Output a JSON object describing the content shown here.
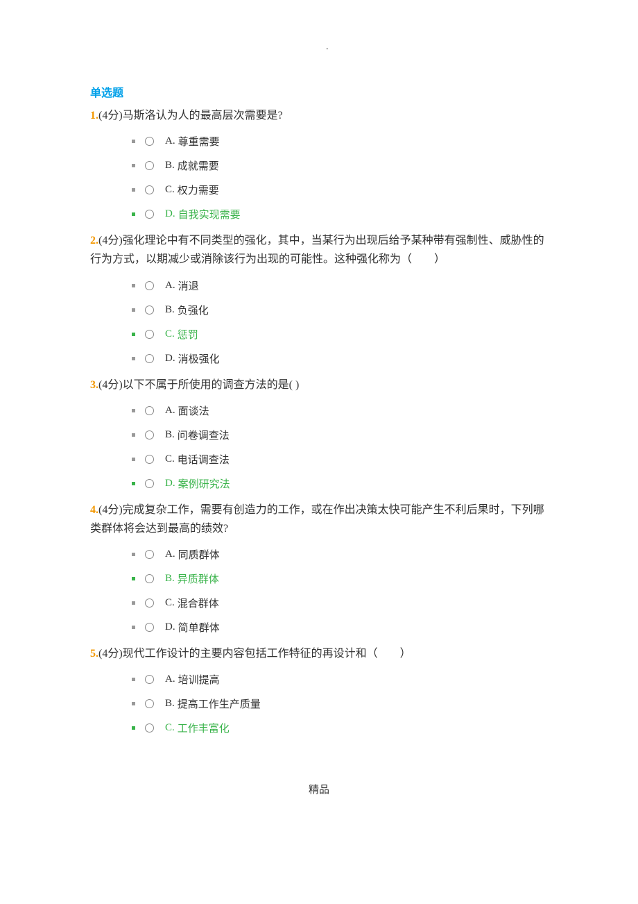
{
  "section_title": "单选题",
  "top_marker": ".",
  "footer": "精品",
  "questions": [
    {
      "number": "1.",
      "points": "(4分)",
      "text": "马斯洛认为人的最高层次需要是?",
      "options": [
        {
          "label": "A.",
          "text": "尊重需要",
          "correct": false
        },
        {
          "label": "B.",
          "text": "成就需要",
          "correct": false
        },
        {
          "label": "C.",
          "text": "权力需要",
          "correct": false
        },
        {
          "label": "D.",
          "text": "自我实现需要",
          "correct": true
        }
      ]
    },
    {
      "number": "2.",
      "points": "(4分)",
      "text": "强化理论中有不同类型的强化，其中，当某行为出现后给予某种带有强制性、威胁性的行为方式，以期减少或消除该行为出现的可能性。这种强化称为（　　）",
      "options": [
        {
          "label": "A.",
          "text": "消退",
          "correct": false
        },
        {
          "label": "B.",
          "text": "负强化",
          "correct": false
        },
        {
          "label": "C.",
          "text": "惩罚",
          "correct": true
        },
        {
          "label": "D.",
          "text": "消极强化",
          "correct": false
        }
      ]
    },
    {
      "number": "3.",
      "points": "(4分)",
      "text": "以下不属于所使用的调查方法的是( )",
      "options": [
        {
          "label": "A.",
          "text": "面谈法",
          "correct": false
        },
        {
          "label": "B.",
          "text": "问卷调查法",
          "correct": false
        },
        {
          "label": "C.",
          "text": "电话调查法",
          "correct": false
        },
        {
          "label": "D.",
          "text": "案例研究法",
          "correct": true
        }
      ]
    },
    {
      "number": "4.",
      "points": "(4分)",
      "text": "完成复杂工作，需要有创造力的工作，或在作出决策太快可能产生不利后果时，下列哪类群体将会达到最高的绩效?",
      "options": [
        {
          "label": "A.",
          "text": "同质群体",
          "correct": false
        },
        {
          "label": "B.",
          "text": "异质群体",
          "correct": true
        },
        {
          "label": "C.",
          "text": "混合群体",
          "correct": false
        },
        {
          "label": "D.",
          "text": "简单群体",
          "correct": false
        }
      ]
    },
    {
      "number": "5.",
      "points": "(4分)",
      "text": "现代工作设计的主要内容包括工作特征的再设计和（　　）",
      "options": [
        {
          "label": "A.",
          "text": "培训提高",
          "correct": false
        },
        {
          "label": "B.",
          "text": "提高工作生产质量",
          "correct": false
        },
        {
          "label": "C.",
          "text": "工作丰富化",
          "correct": true
        }
      ]
    }
  ]
}
